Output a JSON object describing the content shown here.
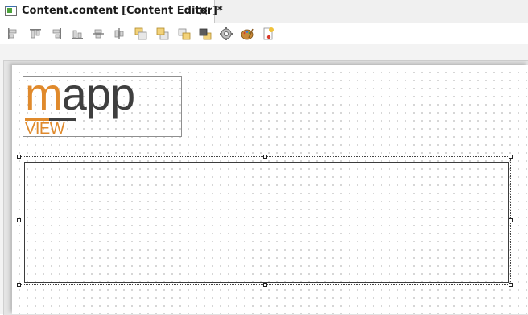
{
  "tab": {
    "title": "Content.content [Content Editor]*",
    "close_glyph": "✕",
    "icon": "content-editor-icon"
  },
  "toolbar": {
    "buttons": [
      {
        "name": "align-left-icon"
      },
      {
        "name": "align-top-icon"
      },
      {
        "name": "align-right-icon"
      },
      {
        "name": "align-bottom-icon"
      },
      {
        "name": "center-vertical-icon"
      },
      {
        "name": "center-horizontal-icon"
      },
      {
        "name": "bring-to-front-icon"
      },
      {
        "name": "send-to-back-icon"
      },
      {
        "name": "bring-forward-icon"
      },
      {
        "name": "send-backward-icon"
      },
      {
        "name": "settings-gear-icon"
      },
      {
        "name": "theme-palette-icon"
      },
      {
        "name": "new-document-icon"
      }
    ]
  },
  "logo": {
    "m": "m",
    "app": "app",
    "view": "VIEW"
  },
  "colors": {
    "accent_orange": "#e08a2c",
    "logo_gray": "#3f3f3f",
    "tab_bg": "#ffffff",
    "editor_bg": "#e4e4e4"
  }
}
